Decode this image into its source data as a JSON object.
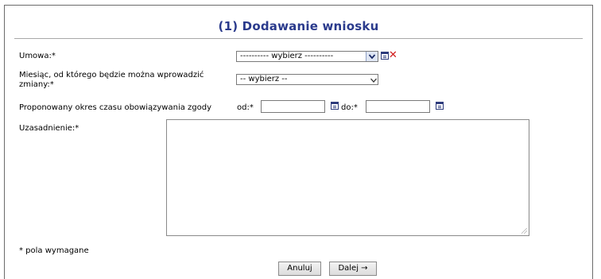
{
  "form": {
    "title": "(1) Dodawanie wniosku",
    "umowa": {
      "label": "Umowa:*",
      "selected": "---------- wybierz ----------"
    },
    "miesiac": {
      "label_line1": "Miesiąc, od którego będzie można wprowadzić",
      "label_line2": "zmiany:*",
      "selected": "-- wybierz --"
    },
    "okres": {
      "label": "Proponowany okres czasu obowiązywania zgody",
      "od_label": "od:*",
      "do_label": "do:*",
      "od_value": "",
      "do_value": ""
    },
    "uzasadnienie": {
      "label": "Uzasadnienie:*",
      "value": ""
    },
    "required_note": "* pola wymagane",
    "buttons": {
      "cancel": "Anuluj",
      "next": "Dalej →"
    }
  },
  "colors": {
    "title": "#2a3a8c",
    "clear_icon": "#d11a1a",
    "calendar_icon": "#2d3b7c"
  },
  "icons": [
    "calendar-icon",
    "clear-x-icon",
    "chevron-down-icon",
    "resize-grip-icon"
  ]
}
